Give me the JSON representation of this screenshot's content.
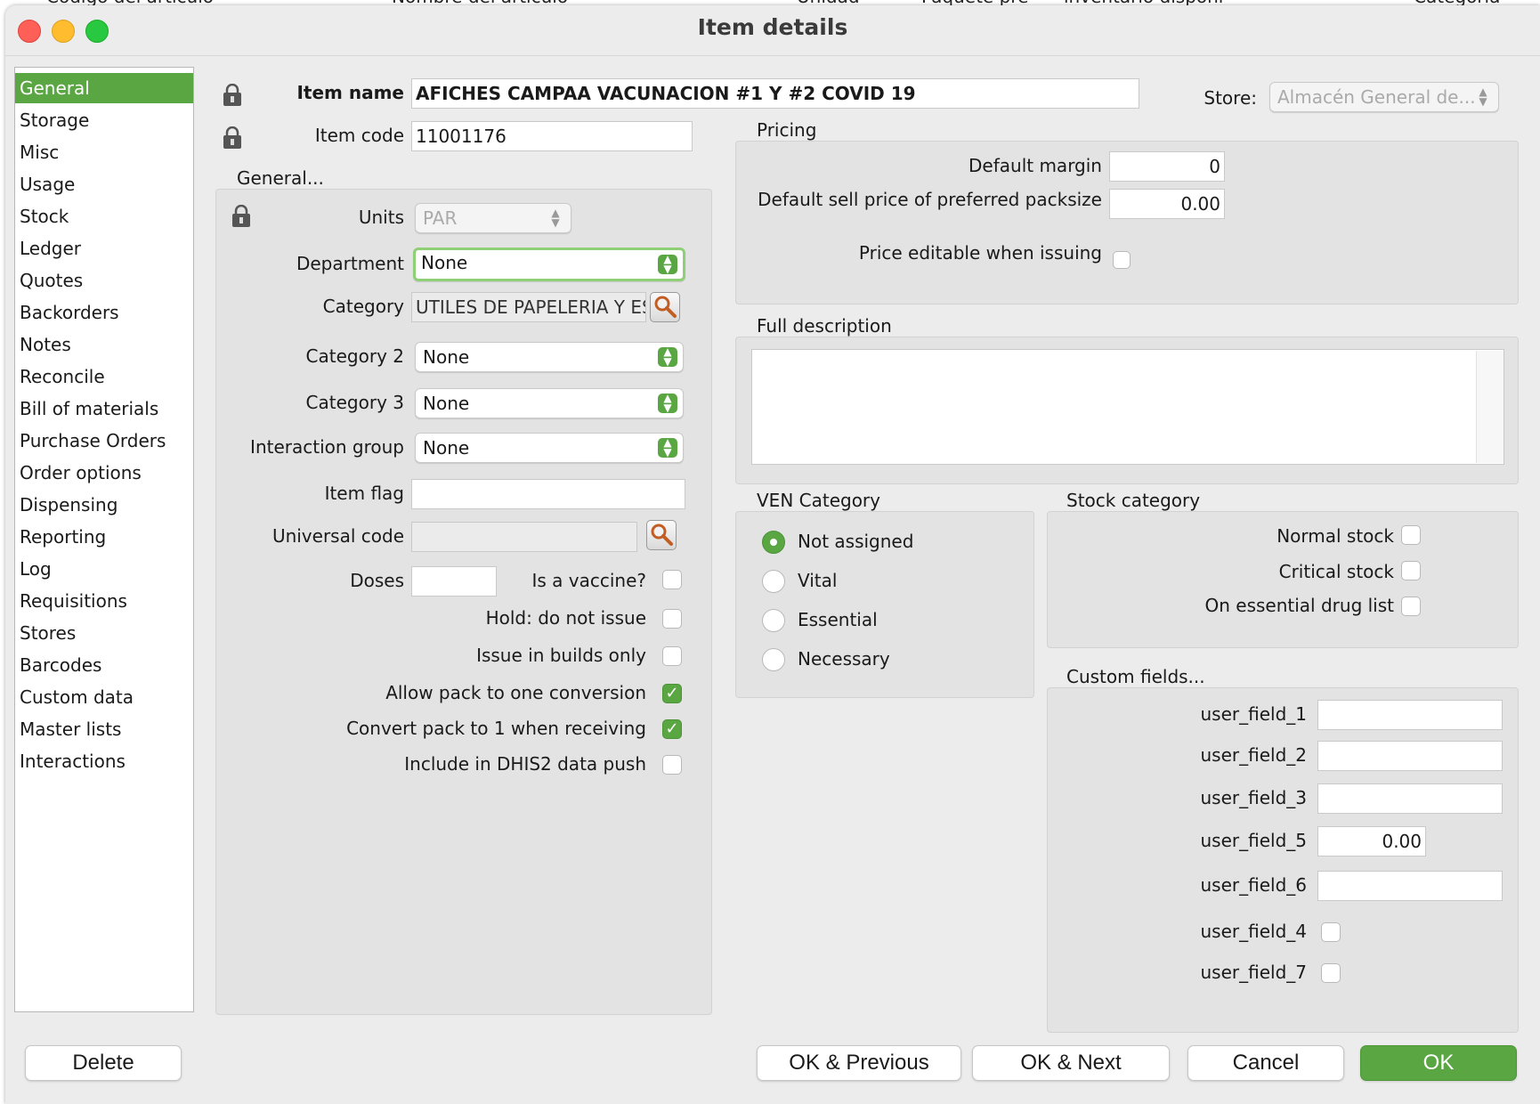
{
  "background_table": {
    "columns": [
      "Codigo del artículo",
      "Nombre del artículo",
      "Unidad",
      "Paquete pre",
      "inventario disponi",
      "Categoría"
    ]
  },
  "window": {
    "title": "Item details",
    "controls": [
      "close",
      "minimize",
      "zoom"
    ]
  },
  "sidebar": {
    "items": [
      {
        "label": "General",
        "selected": true
      },
      {
        "label": "Storage"
      },
      {
        "label": "Misc"
      },
      {
        "label": "Usage"
      },
      {
        "label": "Stock"
      },
      {
        "label": "Ledger"
      },
      {
        "label": "Quotes"
      },
      {
        "label": "Backorders"
      },
      {
        "label": "Notes"
      },
      {
        "label": "Reconcile"
      },
      {
        "label": "Bill of materials"
      },
      {
        "label": "Purchase Orders"
      },
      {
        "label": "Order options"
      },
      {
        "label": "Dispensing"
      },
      {
        "label": "Reporting"
      },
      {
        "label": "Log"
      },
      {
        "label": "Requisitions"
      },
      {
        "label": "Stores"
      },
      {
        "label": "Barcodes"
      },
      {
        "label": "Custom data"
      },
      {
        "label": "Master lists"
      },
      {
        "label": "Interactions"
      }
    ]
  },
  "header": {
    "item_name_label": "Item name",
    "item_name_value": "AFICHES CAMPAA VACUNACION #1 Y #2 COVID 19",
    "item_code_label": "Item code",
    "item_code_value": "11001176",
    "store_label": "Store:",
    "store_value": "Almacén General de..."
  },
  "general": {
    "section_label": "General...",
    "units_label": "Units",
    "units_value": "PAR",
    "department_label": "Department",
    "department_value": "None",
    "category_label": "Category",
    "category_value": "UTILES DE PAPELERIA Y ESC",
    "category2_label": "Category 2",
    "category2_value": "None",
    "category3_label": "Category 3",
    "category3_value": "None",
    "interaction_label": "Interaction group",
    "interaction_value": "None",
    "item_flag_label": "Item flag",
    "item_flag_value": "",
    "universal_code_label": "Universal code",
    "universal_code_value": "",
    "doses_label": "Doses",
    "doses_value": "",
    "checkboxes": [
      {
        "label": "Is a vaccine?",
        "checked": false
      },
      {
        "label": "Hold: do not issue",
        "checked": false
      },
      {
        "label": "Issue in builds only",
        "checked": false
      },
      {
        "label": "Allow pack to one conversion",
        "checked": true
      },
      {
        "label": "Convert pack to 1 when receiving",
        "checked": true
      },
      {
        "label": "Include in DHIS2 data push",
        "checked": false
      }
    ]
  },
  "pricing": {
    "section_label": "Pricing",
    "margin_label": "Default margin",
    "margin_value": "0",
    "sell_price_label": "Default sell price of preferred packsize",
    "sell_price_value": "0.00",
    "price_editable_label": "Price editable when issuing",
    "price_editable_checked": false
  },
  "description": {
    "section_label": "Full description",
    "value": ""
  },
  "ven": {
    "section_label": "VEN Category",
    "options": [
      {
        "label": "Not assigned",
        "selected": true
      },
      {
        "label": "Vital",
        "selected": false
      },
      {
        "label": "Essential",
        "selected": false
      },
      {
        "label": "Necessary",
        "selected": false
      }
    ]
  },
  "stock_category": {
    "section_label": "Stock category",
    "options": [
      {
        "label": "Normal stock",
        "checked": false
      },
      {
        "label": "Critical stock",
        "checked": false
      },
      {
        "label": "On essential drug list",
        "checked": false
      }
    ]
  },
  "custom_fields": {
    "section_label": "Custom fields...",
    "fields": [
      {
        "label": "user_field_1",
        "value": ""
      },
      {
        "label": "user_field_2",
        "value": ""
      },
      {
        "label": "user_field_3",
        "value": ""
      },
      {
        "label": "user_field_5",
        "value": "0.00"
      },
      {
        "label": "user_field_6",
        "value": ""
      }
    ],
    "checkboxes": [
      {
        "label": "user_field_4",
        "checked": false
      },
      {
        "label": "user_field_7",
        "checked": false
      }
    ]
  },
  "footer": {
    "delete_label": "Delete",
    "ok_previous_label": "OK & Previous",
    "ok_next_label": "OK & Next",
    "cancel_label": "Cancel",
    "ok_label": "OK"
  },
  "colors": {
    "accent": "#5aa642",
    "close": "#fe5f57",
    "minimize": "#febc2e",
    "zoom": "#28c840"
  }
}
